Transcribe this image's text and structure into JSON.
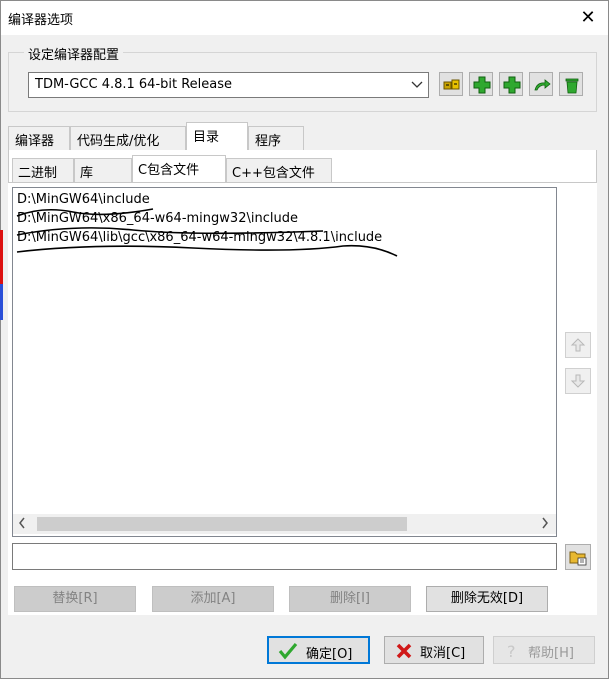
{
  "window": {
    "title": "编译器选项",
    "close_glyph": "✕"
  },
  "config_group": {
    "label": "设定编译器配置",
    "selected": "TDM-GCC 4.8.1 64-bit Release"
  },
  "tabs": [
    {
      "label": "编译器"
    },
    {
      "label": "代码生成/优化"
    },
    {
      "label": "目录"
    },
    {
      "label": "程序"
    }
  ],
  "subtabs": [
    {
      "label": "二进制"
    },
    {
      "label": "库"
    },
    {
      "label": "C包含文件"
    },
    {
      "label": "C++包含文件"
    }
  ],
  "include_dirs": [
    "D:\\MinGW64\\include",
    "D:\\MinGW64\\x86_64-w64-mingw32\\include",
    "D:\\MinGW64\\lib\\gcc\\x86_64-w64-mingw32\\4.8.1\\include"
  ],
  "path_input": {
    "value": ""
  },
  "actions": {
    "replace": "替换[R]",
    "add": "添加[A]",
    "delete": "删除[I]",
    "delete_invalid": "删除无效[D]"
  },
  "buttons": {
    "ok": "确定[O]",
    "cancel": "取消[C]",
    "help": "帮助[H]"
  },
  "colors": {
    "accent": "#0078d7",
    "green": "#2fa82f",
    "cancel_red": "#d01818"
  }
}
